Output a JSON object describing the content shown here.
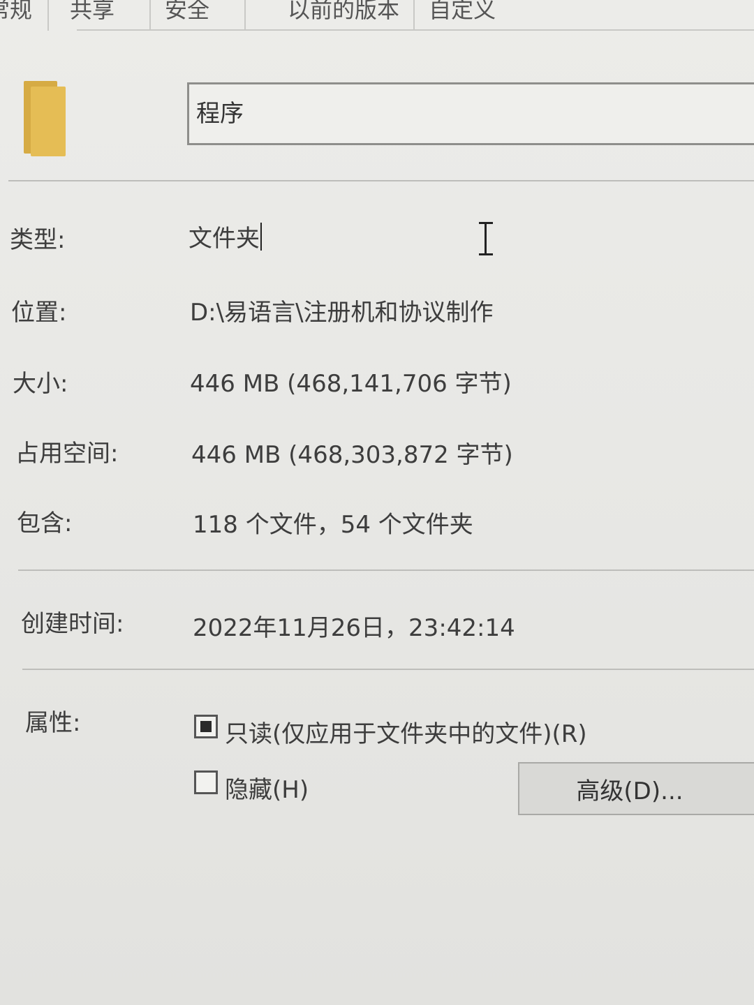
{
  "tabs": [
    {
      "label": "常规"
    },
    {
      "label": "共享"
    },
    {
      "label": "安全"
    },
    {
      "label": "以前的版本"
    },
    {
      "label": "自定义"
    }
  ],
  "folder": {
    "icon": "folder-icon",
    "name": "程序"
  },
  "properties": {
    "type": {
      "label": "类型:",
      "value": "文件夹"
    },
    "location": {
      "label": "位置:",
      "value": "D:\\易语言\\注册机和协议制作"
    },
    "size": {
      "label": "大小:",
      "value": "446 MB (468,141,706 字节)"
    },
    "size_on_disk": {
      "label": "占用空间:",
      "value": "446 MB (468,303,872 字节)"
    },
    "contains": {
      "label": "包含:",
      "value": "118 个文件，54 个文件夹"
    },
    "created": {
      "label": "创建时间:",
      "value": "2022年11月26日，23:42:14"
    }
  },
  "attributes": {
    "label": "属性:",
    "readonly": {
      "label": "只读(仅应用于文件夹中的文件)(R)",
      "state": "indeterminate"
    },
    "hidden": {
      "label": "隐藏(H)",
      "state": "unchecked"
    },
    "advanced_button": "高级(D)..."
  },
  "colors": {
    "folder": "#e5bd55",
    "background": "#e8e8e5"
  }
}
